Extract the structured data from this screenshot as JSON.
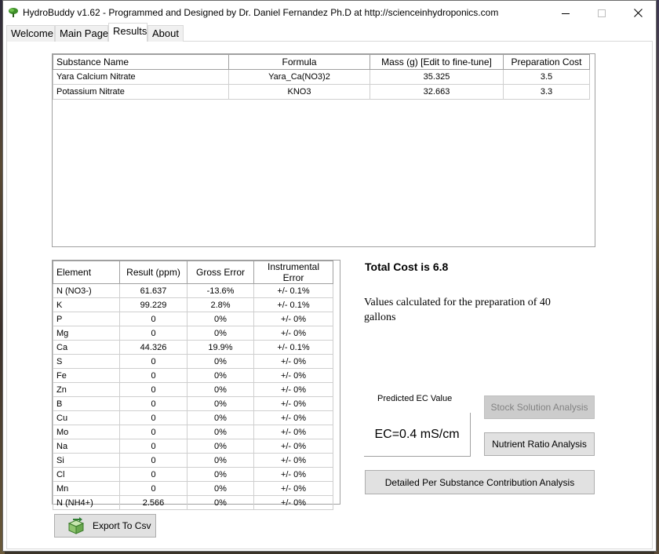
{
  "window": {
    "title": "HydroBuddy v1.62 - Programmed and Designed by Dr. Daniel Fernandez Ph.D at http://scienceinhydroponics.com"
  },
  "tabs": [
    {
      "label": "Welcome",
      "active": false
    },
    {
      "label": "Main Page",
      "active": false
    },
    {
      "label": "Results",
      "active": true
    },
    {
      "label": "About",
      "active": false
    }
  ],
  "substances": {
    "headers": [
      "Substance Name",
      "Formula",
      "Mass (g) [Edit to fine-tune]",
      "Preparation Cost"
    ],
    "rows": [
      [
        "Yara Calcium Nitrate",
        "Yara_Ca(NO3)2",
        "35.325",
        "3.5"
      ],
      [
        "Potassium Nitrate",
        "KNO3",
        "32.663",
        "3.3"
      ]
    ]
  },
  "elements": {
    "headers": [
      "Element",
      "Result (ppm)",
      "Gross Error",
      "Instrumental Error"
    ],
    "rows": [
      [
        "N (NO3-)",
        "61.637",
        "-13.6%",
        "+/- 0.1%"
      ],
      [
        "K",
        "99.229",
        "2.8%",
        "+/- 0.1%"
      ],
      [
        "P",
        "0",
        "0%",
        "+/- 0%"
      ],
      [
        "Mg",
        "0",
        "0%",
        "+/- 0%"
      ],
      [
        "Ca",
        "44.326",
        "19.9%",
        "+/- 0.1%"
      ],
      [
        "S",
        "0",
        "0%",
        "+/- 0%"
      ],
      [
        "Fe",
        "0",
        "0%",
        "+/- 0%"
      ],
      [
        "Zn",
        "0",
        "0%",
        "+/- 0%"
      ],
      [
        "B",
        "0",
        "0%",
        "+/- 0%"
      ],
      [
        "Cu",
        "0",
        "0%",
        "+/- 0%"
      ],
      [
        "Mo",
        "0",
        "0%",
        "+/- 0%"
      ],
      [
        "Na",
        "0",
        "0%",
        "+/- 0%"
      ],
      [
        "Si",
        "0",
        "0%",
        "+/- 0%"
      ],
      [
        "Cl",
        "0",
        "0%",
        "+/- 0%"
      ],
      [
        "Mn",
        "0",
        "0%",
        "+/- 0%"
      ],
      [
        "N (NH4+)",
        "2.566",
        "0%",
        "+/- 0%"
      ]
    ]
  },
  "summary": {
    "total_cost": "Total Cost is 6.8",
    "values_calculated": "Values calculated for the preparation of 40 gallons",
    "ec_label": "Predicted EC Value",
    "ec_value": "EC=0.4 mS/cm"
  },
  "buttons": {
    "stock_solution": "Stock Solution Analysis",
    "nutrient_ratio": "Nutrient Ratio Analysis",
    "detailed": "Detailed Per Substance Contribution Analysis",
    "export_csv": "Export To Csv"
  },
  "icons": {
    "app": "plant-icon",
    "export": "export-box-icon",
    "minimize": "minimize-icon",
    "maximize": "maximize-icon",
    "close": "close-icon"
  }
}
